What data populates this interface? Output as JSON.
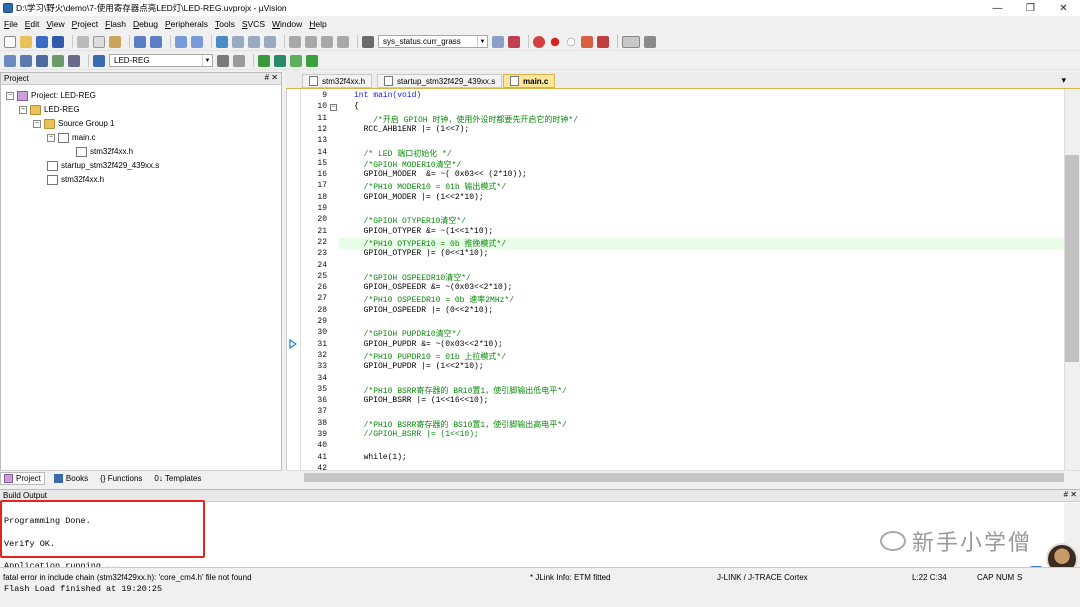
{
  "window": {
    "title": "D:\\学习\\野火\\demo\\7-使用寄存器点亮LED灯\\LED-REG.uvprojx - µVision",
    "controls": [
      "—",
      "❐",
      "✕"
    ]
  },
  "menu": [
    "File",
    "Edit",
    "View",
    "Project",
    "Flash",
    "Debug",
    "Peripherals",
    "Tools",
    "SVCS",
    "Window",
    "Help"
  ],
  "toolbar1": {
    "search_combo": "sys_status.curr_grass"
  },
  "toolbar2": {
    "target_combo": "LED-REG"
  },
  "project_pane": {
    "title": "Project",
    "ctl": "# ✕",
    "tree": [
      {
        "label": "Project: LED-REG",
        "icon": "project-icon",
        "exp": "−"
      },
      {
        "label": "LED-REG",
        "icon": "folder-icon",
        "exp": "−"
      },
      {
        "label": "Source Group 1",
        "icon": "folder-icon",
        "exp": "−"
      },
      {
        "label": "main.c",
        "icon": "file-icon",
        "exp": "−"
      },
      {
        "label": "stm32f4xx.h",
        "icon": "file-icon",
        "exp": ""
      },
      {
        "label": "startup_stm32f429_439xx.s",
        "icon": "file-icon",
        "exp": ""
      },
      {
        "label": "stm32f4xx.h",
        "icon": "file-icon",
        "exp": ""
      }
    ],
    "tabs": [
      "Project",
      "Books",
      "{} Functions",
      "0↓ Templates"
    ]
  },
  "editor_tabs": [
    "stm32f4xx.h",
    "startup_stm32f429_439xx.s",
    "main.c"
  ],
  "editor_tab_menu": "▾",
  "code_lines": [
    {
      "n": "9",
      "t": "int main(void)",
      "c": "kw"
    },
    {
      "n": "10",
      "t": "{",
      "fold": "−"
    },
    {
      "n": "11",
      "t": "    /*开启 GPIOH 时钟，使用外设时都要先开启它的时钟*/",
      "c": "cm"
    },
    {
      "n": "12",
      "t": "  RCC_AHB1ENR |= (1<<7);"
    },
    {
      "n": "13",
      "t": ""
    },
    {
      "n": "14",
      "t": "  /* LED 端口初始化 */",
      "c": "cm"
    },
    {
      "n": "15",
      "t": "  /*GPIOH MODER10清空*/",
      "c": "cm"
    },
    {
      "n": "16",
      "t": "  GPIOH_MODER  &= ~( 0x03<< (2*10));"
    },
    {
      "n": "17",
      "t": "  /*PH10 MODER10 = 01b 输出模式*/",
      "c": "cm"
    },
    {
      "n": "18",
      "t": "  GPIOH_MODER |= (1<<2*10);"
    },
    {
      "n": "19",
      "t": ""
    },
    {
      "n": "20",
      "t": "  /*GPIOH OTYPER10清空*/",
      "c": "cm"
    },
    {
      "n": "21",
      "t": "  GPIOH_OTYPER &= ~(1<<1*10);"
    },
    {
      "n": "22",
      "t": "  /*PH10 OTYPER10 = 0b 推挽模式*/",
      "c": "cm",
      "hl": true
    },
    {
      "n": "23",
      "t": "  GPIOH_OTYPER |= (0<<1*10);"
    },
    {
      "n": "24",
      "t": ""
    },
    {
      "n": "25",
      "t": "  /*GPIOH OSPEEDR10清空*/",
      "c": "cm"
    },
    {
      "n": "26",
      "t": "  GPIOH_OSPEEDR &= ~(0x03<<2*10);"
    },
    {
      "n": "27",
      "t": "  /*PH10 OSPEEDR10 = 0b 速率2MHz*/",
      "c": "cm"
    },
    {
      "n": "28",
      "t": "  GPIOH_OSPEEDR |= (0<<2*10);"
    },
    {
      "n": "29",
      "t": ""
    },
    {
      "n": "30",
      "t": "  /*GPIOH PUPDR10清空*/",
      "c": "cm"
    },
    {
      "n": "31",
      "t": "  GPIOH_PUPDR &= ~(0x03<<2*10);"
    },
    {
      "n": "32",
      "t": "  /*PH10 PUPDR10 = 01b 上拉模式*/",
      "c": "cm"
    },
    {
      "n": "33",
      "t": "  GPIOH_PUPDR |= (1<<2*10);"
    },
    {
      "n": "34",
      "t": ""
    },
    {
      "n": "35",
      "t": "  /*PH10 BSRR寄存器的 BR10置1，使引脚输出低电平*/",
      "c": "cm"
    },
    {
      "n": "36",
      "t": "  GPIOH_BSRR |= (1<<16<<10);"
    },
    {
      "n": "37",
      "t": ""
    },
    {
      "n": "38",
      "t": "  /*PH10 BSRR寄存器的 BS10置1，使引脚输出高电平*/",
      "c": "cm"
    },
    {
      "n": "39",
      "t": "  //GPIOH_BSRR |= (1<<10);",
      "c": "cm"
    },
    {
      "n": "40",
      "t": ""
    },
    {
      "n": "41",
      "t": "  while(1);"
    },
    {
      "n": "42",
      "t": ""
    }
  ],
  "build_output": {
    "title": "Build Output",
    "ctl": "# ✕",
    "lines": [
      "Programming Done.",
      "Verify OK.",
      "Application running ...",
      "Flash Load finished at 19:20:25"
    ]
  },
  "watermark": "新手小学僧",
  "ime_badge": "英",
  "status": {
    "error": "fatal error in include chain (stm32f429xx.h): 'core_cm4.h' file not found",
    "jlink_info": "* JLink Info: ETM fitted",
    "debugger": "J-LINK / J-TRACE Cortex",
    "position": "L:22 C:34",
    "caps": "CAP",
    "num": "NUM",
    "scrl": "S"
  },
  "colors": {
    "keyword": "#1a1aff",
    "comment": "#0a8a0a",
    "highlight_box": "#e0261f",
    "active_tab": "#fce69a"
  }
}
